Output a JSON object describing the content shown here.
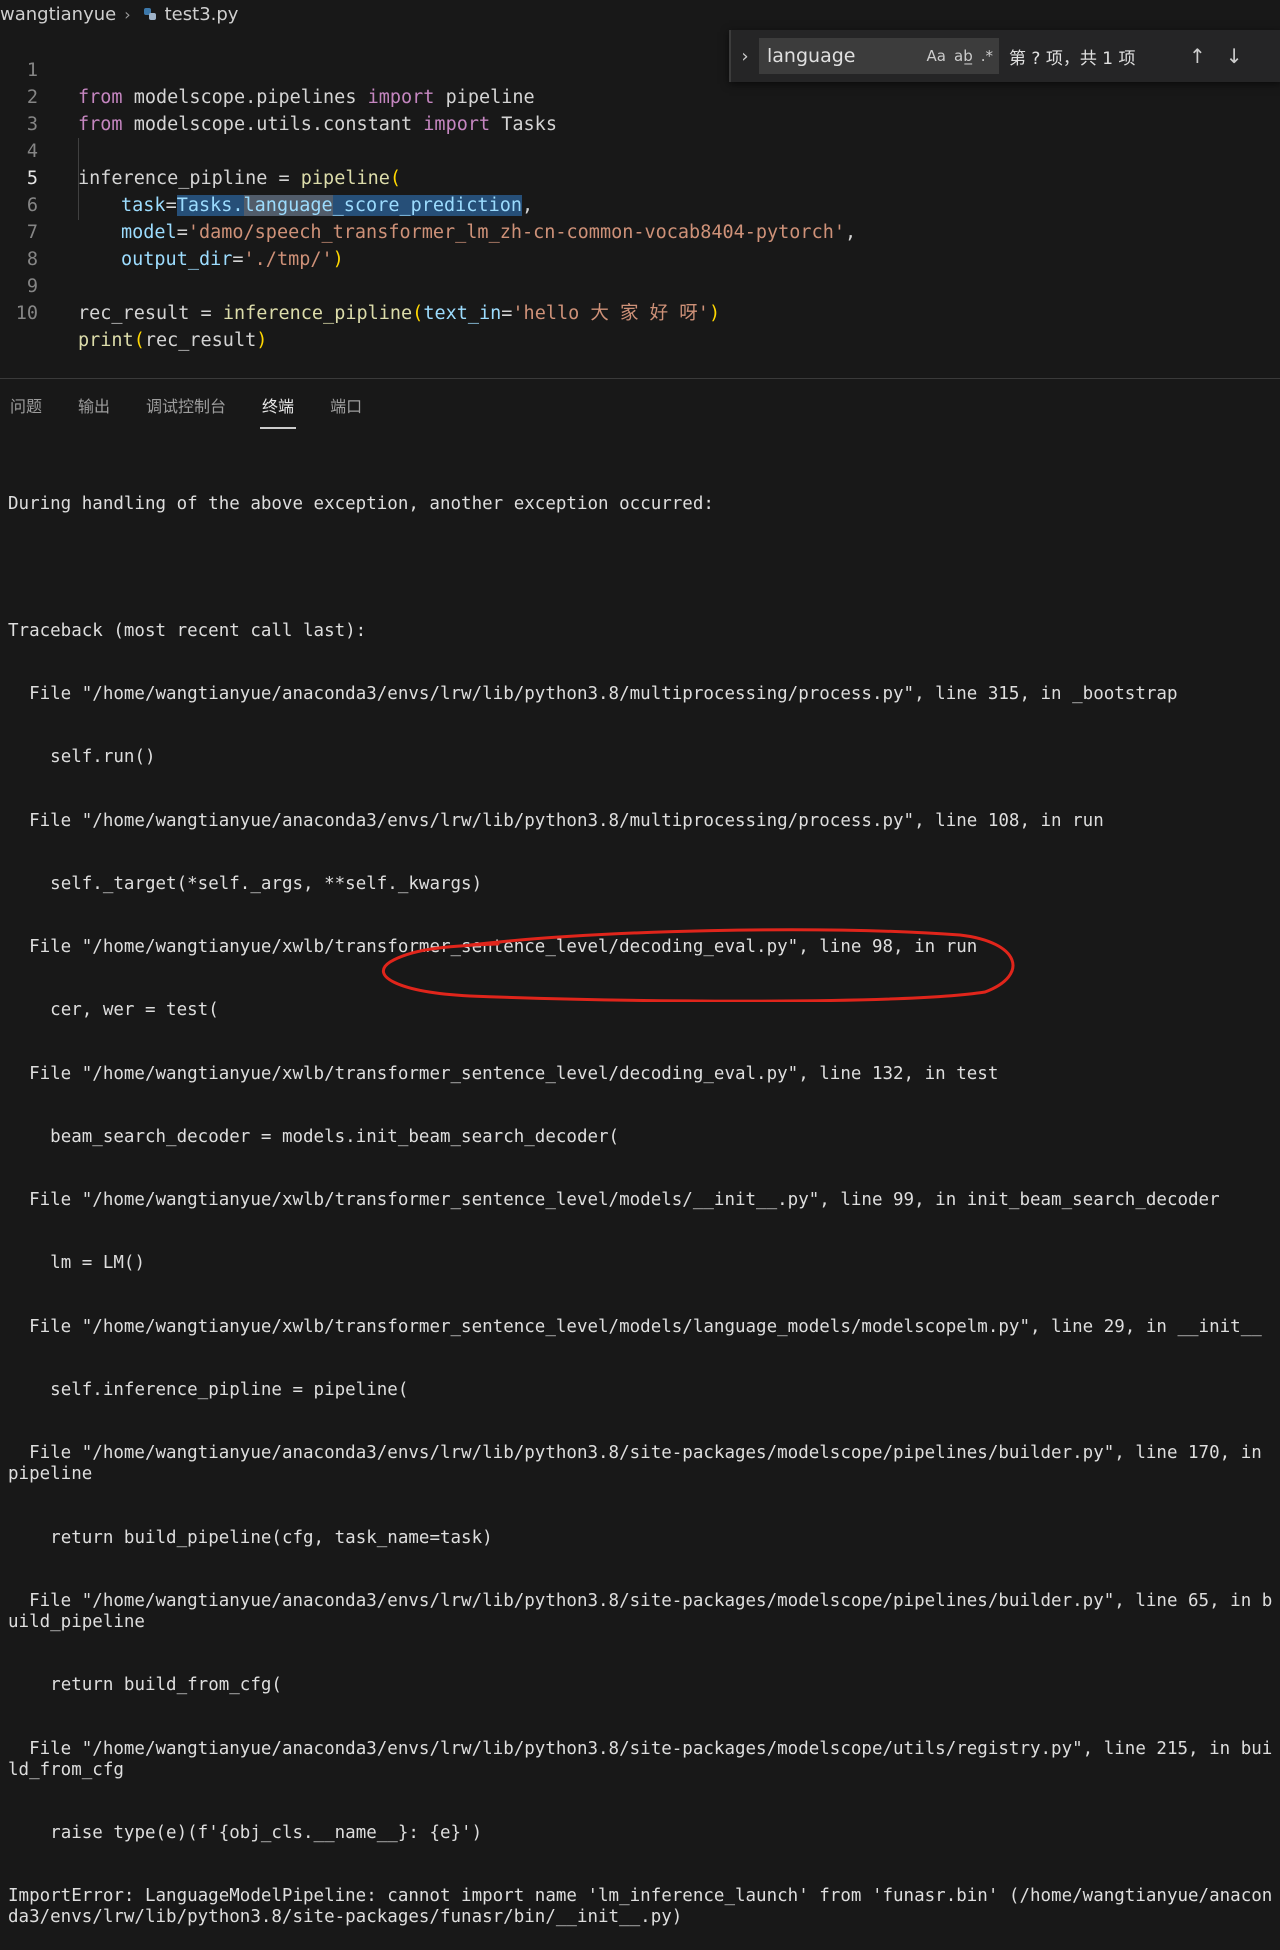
{
  "breadcrumb": {
    "folder": "wangtianyue",
    "file": "test3.py"
  },
  "editor": {
    "line_numbers": [
      "1",
      "2",
      "3",
      "4",
      "5",
      "6",
      "7",
      "8",
      "9",
      "10"
    ],
    "active_line": "5",
    "lines": {
      "l1": {
        "kw1": "from",
        "mod": " modelscope.pipelines ",
        "kw2": "import",
        "name": " pipeline"
      },
      "l2": {
        "kw1": "from",
        "mod": " modelscope.utils.constant ",
        "kw2": "import",
        "name": " Tasks"
      },
      "l4": {
        "var": "inference_pipline",
        "eq": " = ",
        "fn": "pipeline",
        "paren": "("
      },
      "l5": {
        "arg": "task",
        "eq": "=",
        "sel": "Tasks.",
        "match": "language",
        "rest": "_score_prediction",
        "comma": ","
      },
      "l6": {
        "arg": "model",
        "eq": "=",
        "str": "'damo/speech_transformer_lm_zh-cn-common-vocab8404-pytorch'",
        "comma": ","
      },
      "l7": {
        "arg": "output_dir",
        "eq": "=",
        "str": "'./tmp/'",
        "paren": ")"
      },
      "l9": {
        "var": "rec_result",
        "eq": " = ",
        "fn": "inference_pipline",
        "paren1": "(",
        "arg": "text_in",
        "eq2": "=",
        "str": "'hello 大 家 好 呀'",
        "paren2": ")"
      },
      "l10": {
        "fn": "print",
        "paren1": "(",
        "var": "rec_result",
        "paren2": ")"
      }
    }
  },
  "find_widget": {
    "value": "language",
    "match_case": "Aa",
    "whole_word": "ab̲",
    "regex": ".*",
    "count": "第 ? 项，共 1 项",
    "prev": "↑",
    "next": "↓",
    "toggle": "›"
  },
  "panel": {
    "tabs": [
      "问题",
      "输出",
      "调试控制台",
      "终端",
      "端口"
    ],
    "active_tab": "终端"
  },
  "terminal": {
    "lines": [
      "During handling of the above exception, another exception occurred:",
      "",
      "Traceback (most recent call last):",
      "  File \"/home/wangtianyue/anaconda3/envs/lrw/lib/python3.8/multiprocessing/process.py\", line 315, in _bootstrap",
      "    self.run()",
      "  File \"/home/wangtianyue/anaconda3/envs/lrw/lib/python3.8/multiprocessing/process.py\", line 108, in run",
      "    self._target(*self._args, **self._kwargs)",
      "  File \"/home/wangtianyue/xwlb/transformer_sentence_level/decoding_eval.py\", line 98, in run",
      "    cer, wer = test(",
      "  File \"/home/wangtianyue/xwlb/transformer_sentence_level/decoding_eval.py\", line 132, in test",
      "    beam_search_decoder = models.init_beam_search_decoder(",
      "  File \"/home/wangtianyue/xwlb/transformer_sentence_level/models/__init__.py\", line 99, in init_beam_search_decoder",
      "    lm = LM()",
      "  File \"/home/wangtianyue/xwlb/transformer_sentence_level/models/language_models/modelscopelm.py\", line 29, in __init__",
      "    self.inference_pipline = pipeline(",
      "  File \"/home/wangtianyue/anaconda3/envs/lrw/lib/python3.8/site-packages/modelscope/pipelines/builder.py\", line 170, in pipeline",
      "    return build_pipeline(cfg, task_name=task)",
      "  File \"/home/wangtianyue/anaconda3/envs/lrw/lib/python3.8/site-packages/modelscope/pipelines/builder.py\", line 65, in build_pipeline",
      "    return build_from_cfg(",
      "  File \"/home/wangtianyue/anaconda3/envs/lrw/lib/python3.8/site-packages/modelscope/utils/registry.py\", line 215, in build_from_cfg",
      "    raise type(e)(f'{obj_cls.__name__}: {e}')",
      "ImportError: LanguageModelPipeline: cannot import name 'lm_inference_launch' from 'funasr.bin' (/home/wangtianyue/anaconda3/envs/lrw/lib/python3.8/site-packages/funasr/bin/__init__.py)"
    ]
  },
  "colors": {
    "background": "#181818",
    "keyword": "#c586c0",
    "function": "#dcdcaa",
    "variable": "#9cdcfe",
    "string": "#ce9178",
    "annotation": "#e0251b"
  }
}
